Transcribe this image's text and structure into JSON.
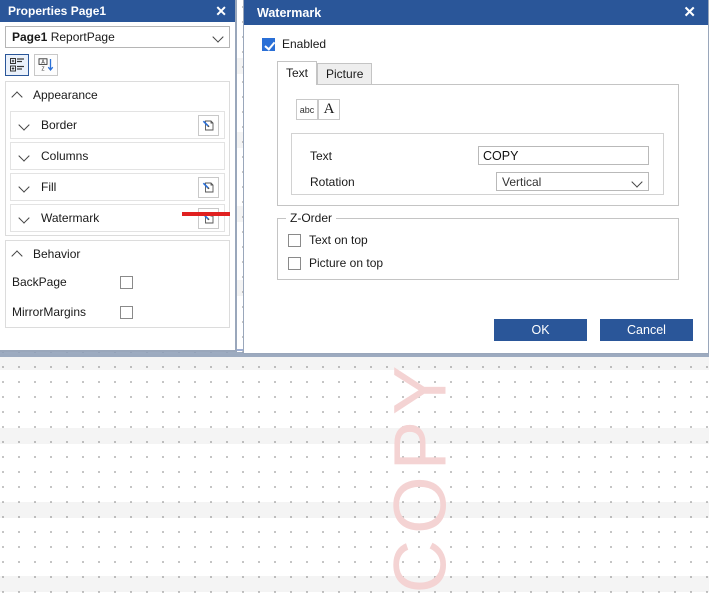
{
  "properties_panel": {
    "title": "Properties Page1",
    "close_icon": "close-icon",
    "object_combo": {
      "name": "Page1",
      "type": "ReportPage",
      "chevron_icon": "chevron-down-icon"
    },
    "toolbar": {
      "categorized_button": "categorized-view-icon",
      "alphabetical_button": "alphabetical-sort-icon"
    },
    "groups": [
      {
        "label": "Appearance",
        "chevron": "chevron-up-icon",
        "rows": [
          {
            "label": "Border",
            "chevron": "chevron-down-icon",
            "editor": "editor-pen-page-icon",
            "has_editor": true
          },
          {
            "label": "Columns",
            "chevron": "chevron-down-icon",
            "editor": "",
            "has_editor": false
          },
          {
            "label": "Fill",
            "chevron": "chevron-down-icon",
            "editor": "editor-pen-page-icon",
            "has_editor": true
          },
          {
            "label": "Watermark",
            "chevron": "chevron-down-icon",
            "editor": "editor-pen-page-icon",
            "has_editor": true
          }
        ]
      },
      {
        "label": "Behavior",
        "chevron": "chevron-up-icon",
        "items": [
          {
            "label": "BackPage",
            "checked": false
          },
          {
            "label": "MirrorMargins",
            "checked": false
          }
        ]
      }
    ],
    "highlight_color": "#e02020"
  },
  "dialog": {
    "title": "Watermark",
    "close_icon": "close-icon",
    "enabled": {
      "label": "Enabled",
      "checked": true
    },
    "tabs": [
      {
        "label": "Text",
        "active": true
      },
      {
        "label": "Picture",
        "active": false
      }
    ],
    "font_buttons": [
      {
        "label": "abc",
        "name": "text-color-button"
      },
      {
        "label": "A",
        "name": "font-button"
      }
    ],
    "fields": [
      {
        "label": "Text",
        "value": "COPY",
        "type": "input"
      },
      {
        "label": "Rotation",
        "value": "Vertical",
        "type": "select",
        "chevron": "chevron-down-icon"
      }
    ],
    "zorder": {
      "legend": "Z-Order",
      "options": [
        {
          "label": "Text on top",
          "checked": false
        },
        {
          "label": "Picture on top",
          "checked": false
        }
      ]
    },
    "buttons": [
      {
        "label": "OK",
        "name": "ok-button"
      },
      {
        "label": "Cancel",
        "name": "cancel-button"
      }
    ],
    "accent_color": "#2a5699"
  },
  "canvas": {
    "watermark_text": "COPY",
    "watermark_color": "#f4d3d3"
  }
}
